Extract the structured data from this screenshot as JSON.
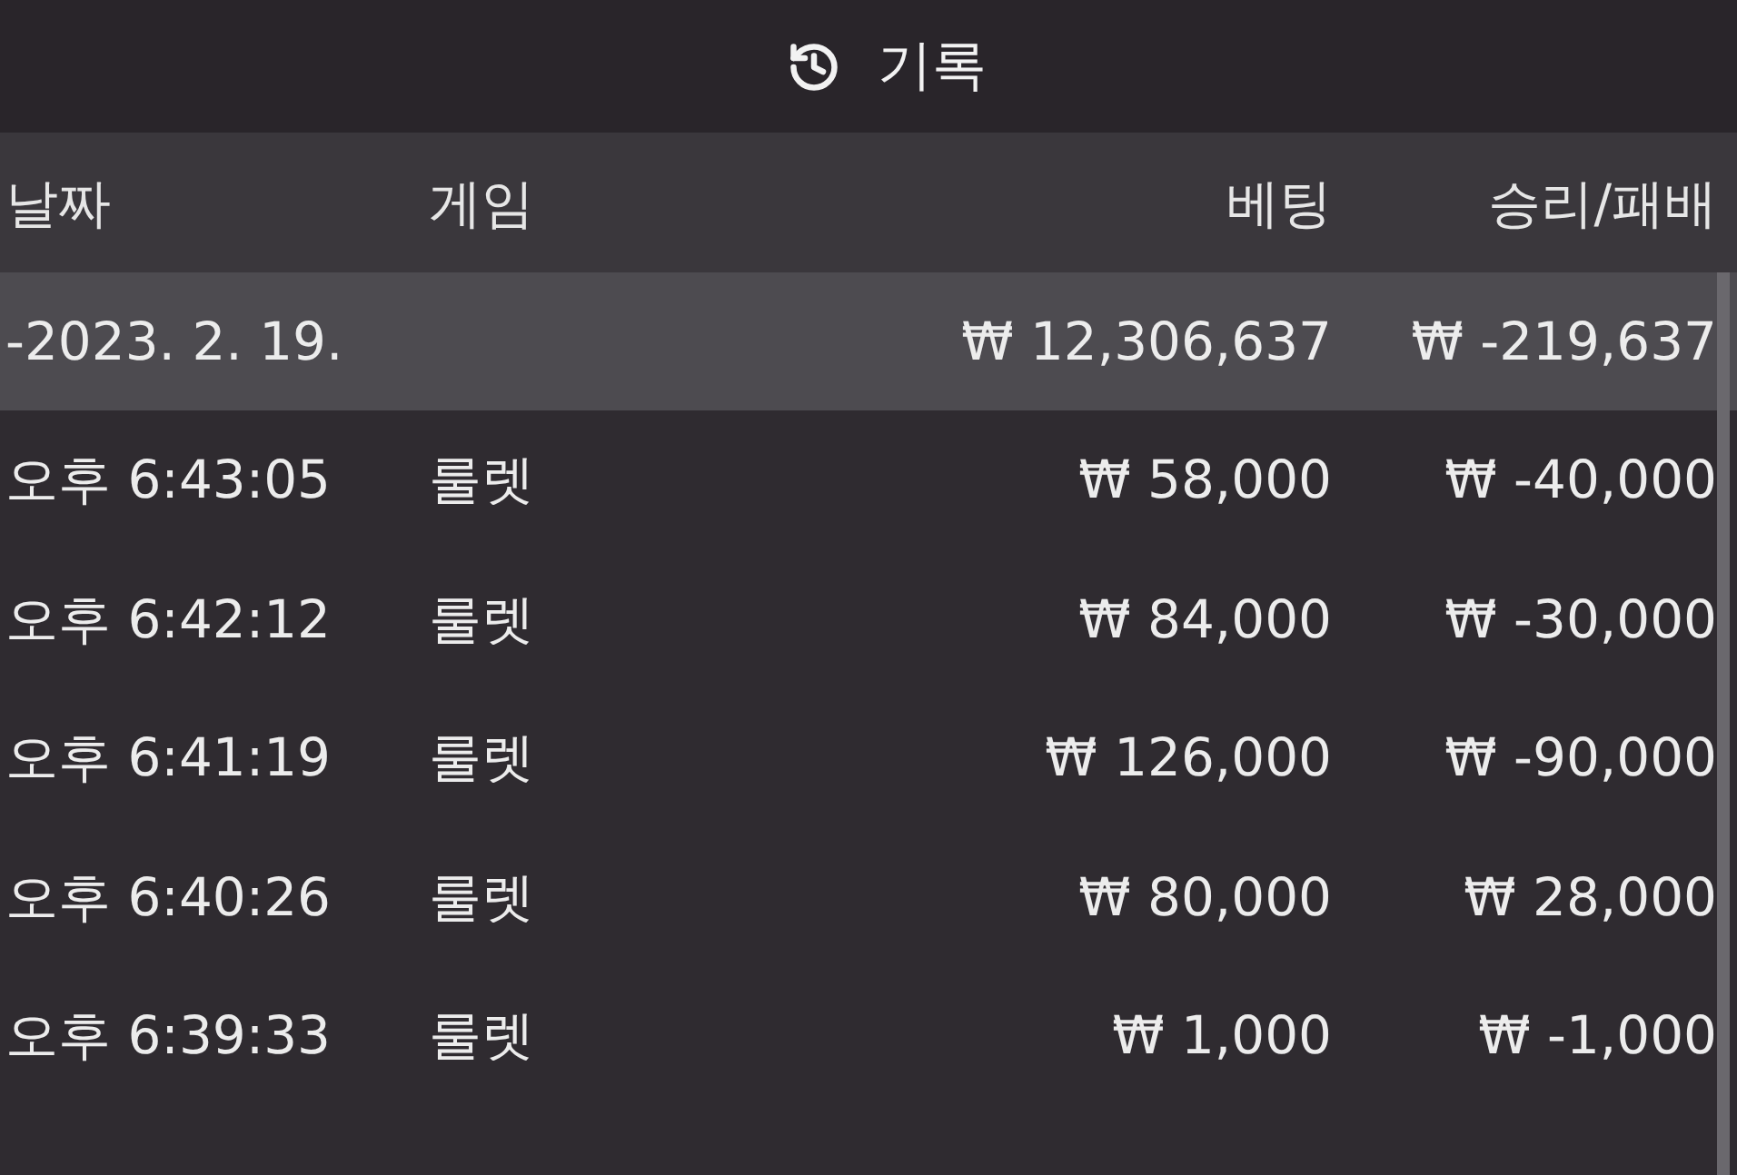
{
  "title": {
    "text": "기록"
  },
  "columns": [
    {
      "label": "날짜"
    },
    {
      "label": "게임"
    },
    {
      "label": "베팅"
    },
    {
      "label": "승리/패배"
    }
  ],
  "groups": [
    {
      "date": "-2023. 2. 19.",
      "bet": "₩ 12,306,637",
      "result": "₩ -219,637",
      "rows": [
        {
          "time": "오후 6:43:05",
          "game": "룰렛",
          "bet": "₩ 58,000",
          "result": "₩ -40,000"
        },
        {
          "time": "오후 6:42:12",
          "game": "룰렛",
          "bet": "₩ 84,000",
          "result": "₩ -30,000"
        },
        {
          "time": "오후 6:41:19",
          "game": "룰렛",
          "bet": "₩ 126,000",
          "result": "₩ -90,000"
        },
        {
          "time": "오후 6:40:26",
          "game": "룰렛",
          "bet": "₩ 80,000",
          "result": "₩ 28,000"
        },
        {
          "time": "오후 6:39:33",
          "game": "룰렛",
          "bet": "₩ 1,000",
          "result": "₩ -1,000"
        }
      ]
    }
  ]
}
